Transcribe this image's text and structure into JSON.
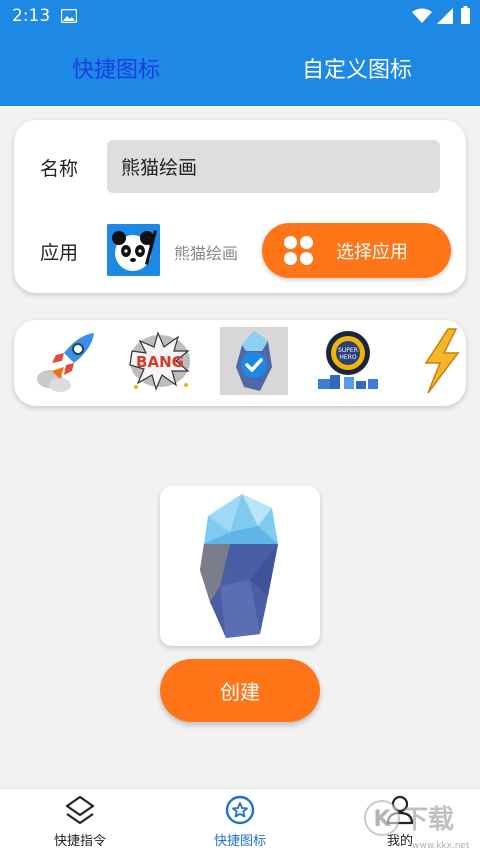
{
  "status_bar": {
    "time": "2:13"
  },
  "header": {
    "tabs": [
      {
        "label": "快捷图标",
        "active": true
      },
      {
        "label": "自定义图标",
        "active": false
      }
    ]
  },
  "form": {
    "name_label": "名称",
    "name_value": "熊猫绘画",
    "app_label": "应用",
    "app_name": "熊猫绘画",
    "select_button": "选择应用"
  },
  "icon_picker": {
    "items": [
      "rocket-icon",
      "bang-icon",
      "iceberg-check-icon",
      "superhero-icon",
      "lightning-icon"
    ]
  },
  "preview": {
    "icon": "iceberg-icon"
  },
  "actions": {
    "create_button": "创建"
  },
  "bottom_nav": {
    "items": [
      {
        "label": "快捷指令",
        "icon": "shortcuts-icon",
        "active": false
      },
      {
        "label": "快捷图标",
        "icon": "star-circle-icon",
        "active": true
      },
      {
        "label": "我的",
        "icon": "user-icon",
        "active": false
      }
    ]
  },
  "watermark": {
    "text": "K下载",
    "sub": "www.kkx.net"
  },
  "colors": {
    "primary": "#1e88e5",
    "accent": "#ff7518",
    "active_tab": "#1a3fe0"
  }
}
